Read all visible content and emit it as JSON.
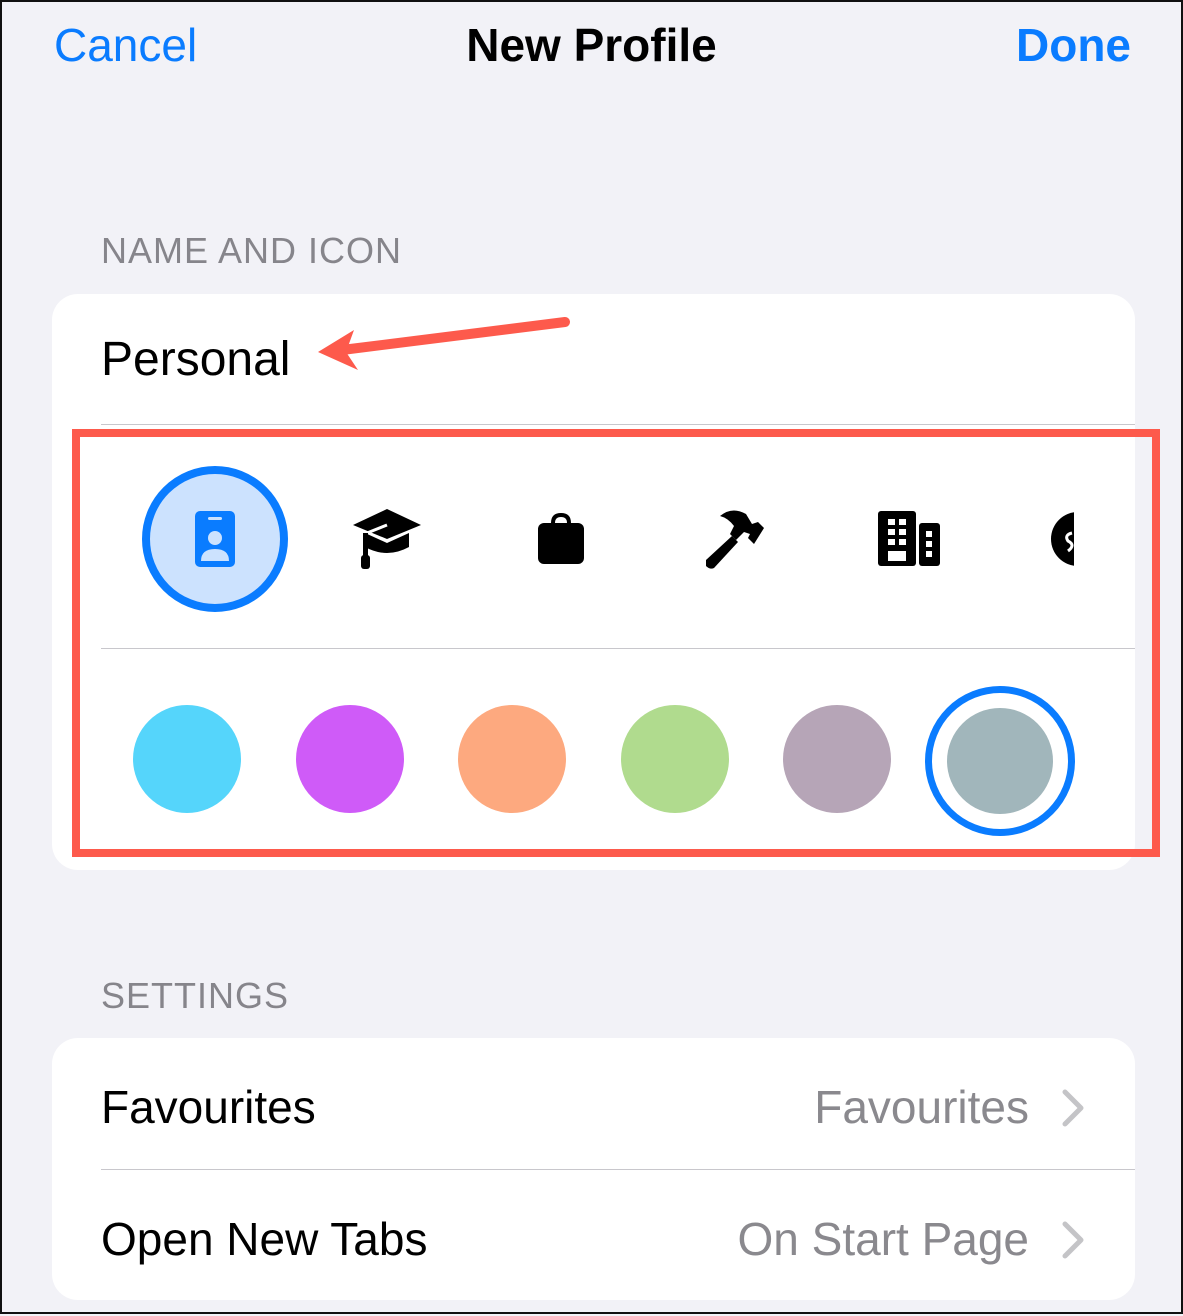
{
  "nav": {
    "cancel_label": "Cancel",
    "title": "New Profile",
    "done_label": "Done"
  },
  "sections": {
    "name_and_icon": {
      "header": "NAME AND ICON",
      "name_value": "Personal",
      "icons": [
        {
          "name": "person-badge-icon",
          "selected": true
        },
        {
          "name": "graduation-cap-icon",
          "selected": false
        },
        {
          "name": "briefcase-icon",
          "selected": false
        },
        {
          "name": "hammer-icon",
          "selected": false
        },
        {
          "name": "building-icon",
          "selected": false
        },
        {
          "name": "dollar-circle-icon",
          "selected": false,
          "partially_visible": true
        }
      ],
      "colors": [
        {
          "name": "cyan",
          "hex": "#55d5fb",
          "selected": false
        },
        {
          "name": "purple",
          "hex": "#cf5bf8",
          "selected": false
        },
        {
          "name": "orange",
          "hex": "#fda97f",
          "selected": false
        },
        {
          "name": "green",
          "hex": "#b0db8e",
          "selected": false
        },
        {
          "name": "mauve",
          "hex": "#b6a5b7",
          "selected": false
        },
        {
          "name": "gray-blue",
          "hex": "#a1b6bb",
          "selected": true
        }
      ]
    },
    "settings": {
      "header": "SETTINGS",
      "rows": [
        {
          "label": "Favourites",
          "value": "Favourites"
        },
        {
          "label": "Open New Tabs",
          "value": "On Start Page"
        }
      ]
    }
  },
  "colors": {
    "accent": "#0a7cff",
    "annotation": "#fd5a4c",
    "background": "#f2f2f7"
  }
}
